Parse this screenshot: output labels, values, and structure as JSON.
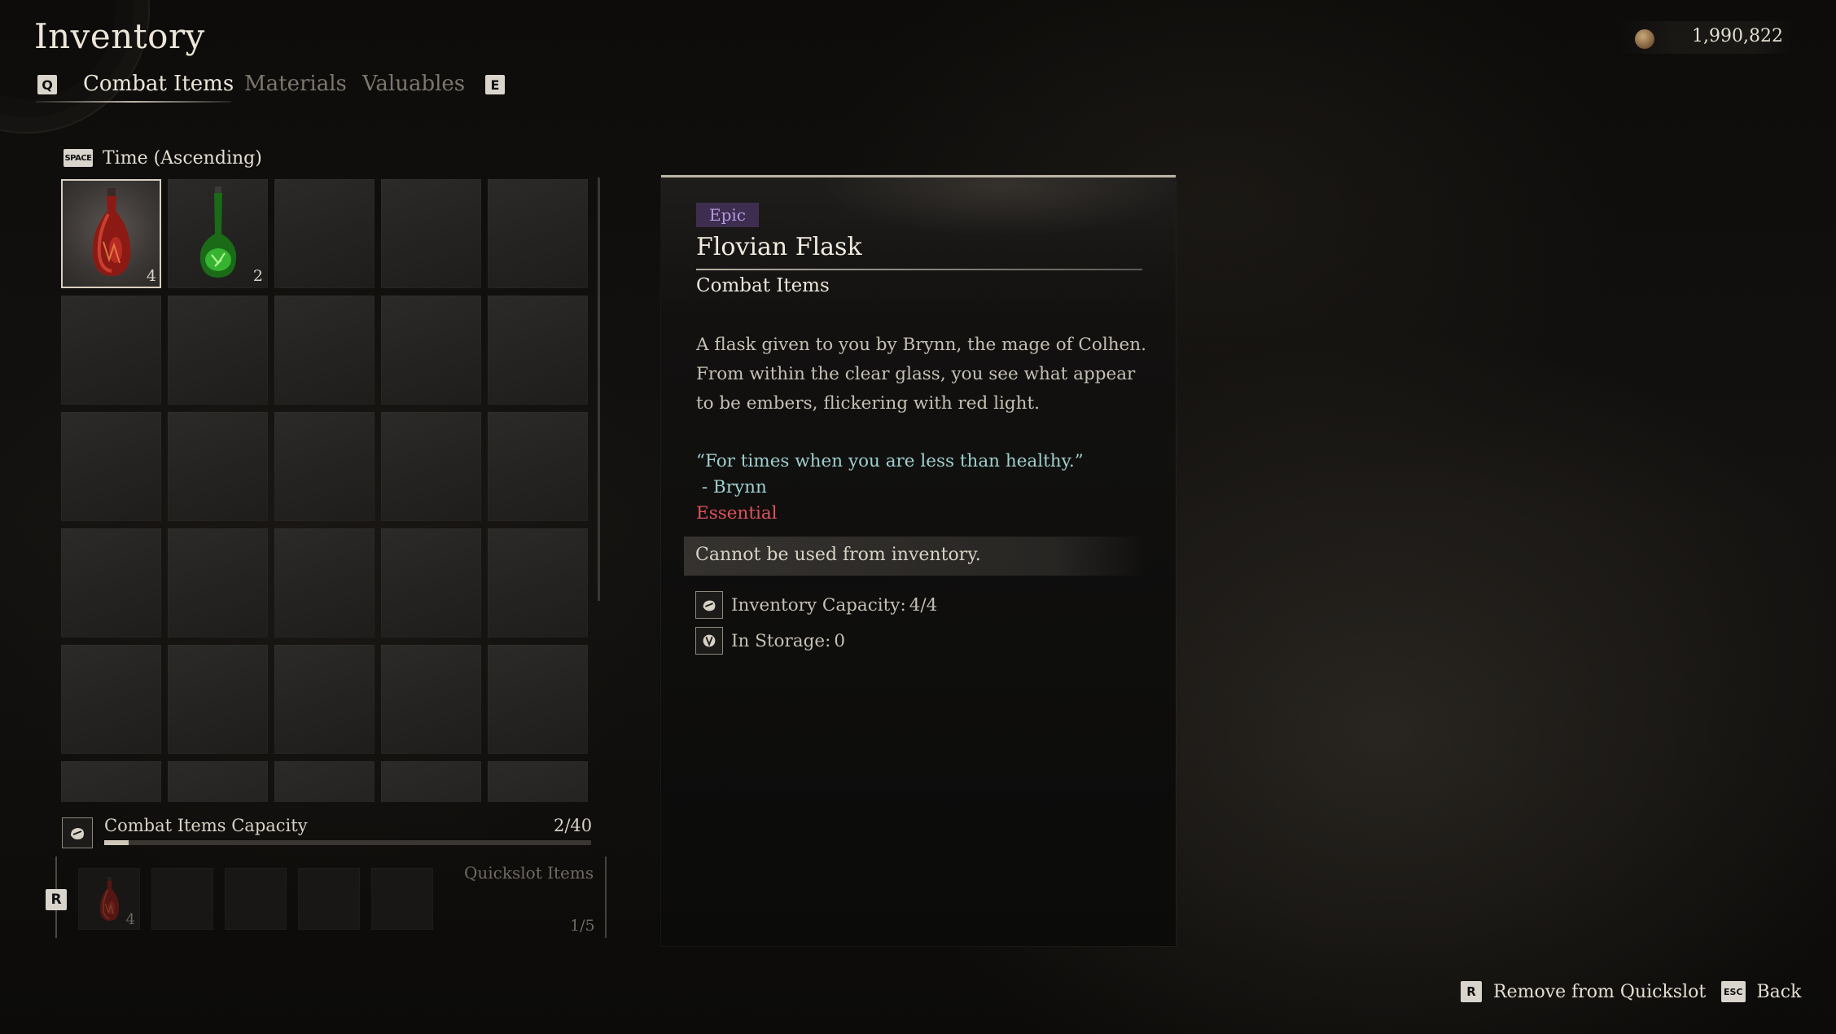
{
  "header": {
    "title": "Inventory",
    "currency": {
      "amount": "1,990,822",
      "icon": "coin-icon"
    }
  },
  "tabs": {
    "prev_key": "Q",
    "next_key": "E",
    "items": [
      {
        "label": "Combat Items",
        "active": true
      },
      {
        "label": "Materials",
        "active": false
      },
      {
        "label": "Valuables",
        "active": false
      }
    ]
  },
  "sort": {
    "key": "SPACE",
    "label": "Time (Ascending)"
  },
  "grid": {
    "columns": 5,
    "items": [
      {
        "name": "Flovian Flask",
        "icon": "red-flask-icon",
        "count": "4",
        "selected": true
      },
      {
        "name": "Green Potion",
        "icon": "green-flask-icon",
        "count": "2",
        "selected": false
      }
    ]
  },
  "capacity": {
    "label": "Combat Items Capacity",
    "value": "2/40",
    "fraction": 0.05,
    "icon": "flask-capacity-icon"
  },
  "quickslot": {
    "key": "R",
    "label": "Quickslot Items",
    "count": "1/5",
    "slots": [
      {
        "icon": "red-flask-icon",
        "count": "4"
      }
    ]
  },
  "detail": {
    "rarity": "Epic",
    "name": "Flovian Flask",
    "category": "Combat Items",
    "description": "A flask given to you by Brynn, the mage of Colhen. From within the clear glass, you see what appear to be embers, flickering with red light.",
    "quote": "“For times when you are less than healthy.”",
    "quote_author": " - Brynn",
    "tag": "Essential",
    "notice": "Cannot be used from inventory.",
    "stats": [
      {
        "label": "Inventory Capacity:",
        "value": "4/4",
        "icon": "flask-capacity-icon"
      },
      {
        "label": "In Storage:",
        "value": "0",
        "icon": "storage-icon"
      }
    ],
    "colors": {
      "rarity_bg": "#3d2e4f",
      "rarity_text": "#b997e3",
      "quote": "#9fd0cf",
      "tag": "#e0525c"
    }
  },
  "footer": {
    "hints": [
      {
        "key": "R",
        "label": "Remove from Quickslot"
      },
      {
        "key": "ESC",
        "label": "Back"
      }
    ]
  }
}
